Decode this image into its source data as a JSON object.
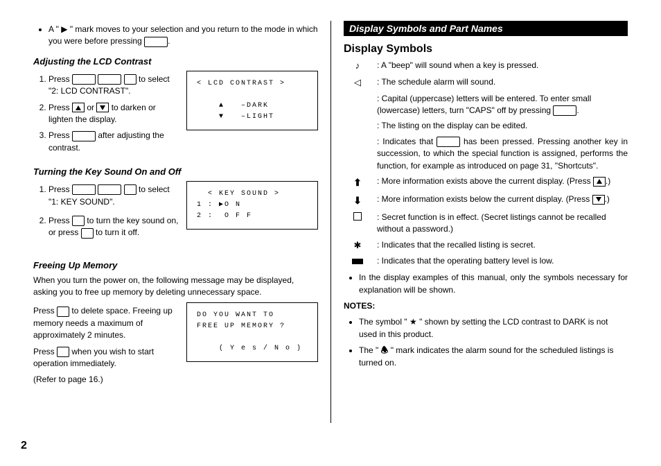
{
  "left": {
    "bullet0": "A \" ▶ \" mark moves to your selection and you return to the mode in which you were before pressing ",
    "bullet0_end": ".",
    "t1": "Adjusting the LCD Contrast",
    "s1_1a": "Press ",
    "s1_1b": " to select \"2: LCD CONTRAST\".",
    "s1_2a": "Press ",
    "s1_2b": " or ",
    "s1_2c": " to darken or lighten the display.",
    "s1_3a": "Press ",
    "s1_3b": " after adjusting the contrast.",
    "disp1": "< LCD CONTRAST >\n\n    ▲   –DARK\n    ▼   –LIGHT",
    "t2": "Turning the Key Sound On and Off",
    "s2_1a": "Press ",
    "s2_1b": " to select \"1: KEY SOUND\".",
    "s2_2a": "Press ",
    "s2_2b": " to turn the key sound on, or press ",
    "s2_2c": " to turn it off.",
    "disp2": "  < KEY SOUND >\n1 : ▶O N\n2 :  O F F",
    "t3": "Freeing Up Memory",
    "p3": "When you turn the power on, the following message may be displayed, asking you to free up memory by deleting unnecessary space.",
    "p3a_1": "Press ",
    "p3a_2": " to delete space. Freeing up memory needs a maximum of approximately 2 minutes.",
    "p3b_1": "Press ",
    "p3b_2": " when you wish to start operation immediately.",
    "p3c": "(Refer to page 16.)",
    "disp3": "DO YOU WANT TO\nFREE UP MEMORY ?\n\n    ( Y e s / N o )"
  },
  "right": {
    "bar": "Display Symbols and Part Names",
    "h2": "Display Symbols",
    "rows": {
      "r1": "A \"beep\" will sound when a key is pressed.",
      "r2": "The schedule alarm will sound.",
      "r3a": "Capital (uppercase) letters will be entered. To enter small (lowercase) letters, turn \"CAPS\" off by pressing ",
      "r3b": ".",
      "r4": "The listing on the display can be edited.",
      "r5a": "Indicates that ",
      "r5b": " has been pressed. Pressing another key in succession, to which the special function is assigned, performs the function, for example as introduced on page 31, \"Shortcuts\".",
      "r6a": "More information exists above the current display. (Press ",
      "r6b": ".)",
      "r7a": "More information exists below the current display. (Press ",
      "r7b": ".)",
      "r8": "Secret function is in effect. (Secret listings cannot be recalled without a password.)",
      "r9": "Indicates that the recalled listing is secret.",
      "r10": "Indicates that the operating battery level is low."
    },
    "bullet1": "In the display examples of this manual, only the symbols necessary for explanation will be shown.",
    "notes": "NOTES:",
    "n1a": "The symbol \" ",
    "n1b": " \" shown by setting the LCD contrast to DARK is not used in this product.",
    "n2a": "The \" ",
    "n2b": " \" mark indicates the alarm sound for the scheduled listings is turned on."
  },
  "page": "2"
}
